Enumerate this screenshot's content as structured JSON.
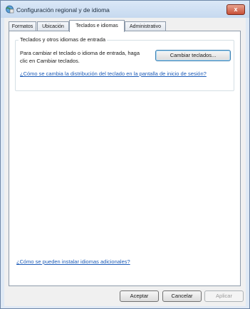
{
  "window": {
    "title": "Configuración regional y de idioma",
    "close_label": "x"
  },
  "tabs": [
    {
      "label": "Formatos"
    },
    {
      "label": "Ubicación"
    },
    {
      "label": "Teclados e idiomas",
      "active": true
    },
    {
      "label": "Administrativo"
    }
  ],
  "keyboards_group": {
    "title": "Teclados y otros idiomas de entrada",
    "description": "Para cambiar el teclado o idioma de entrada, haga clic en Cambiar teclados.",
    "change_button": "Cambiar teclados...",
    "help_link": "¿Cómo se cambia la distribución del teclado en la pantalla de inicio de sesión?"
  },
  "install_link": "¿Cómo se pueden instalar idiomas adicionales?",
  "footer": {
    "ok": "Aceptar",
    "cancel": "Cancelar",
    "apply": "Aplicar"
  },
  "colors": {
    "link": "#1d5cb8",
    "close": "#c75038",
    "accent": "#3c7fb1"
  }
}
